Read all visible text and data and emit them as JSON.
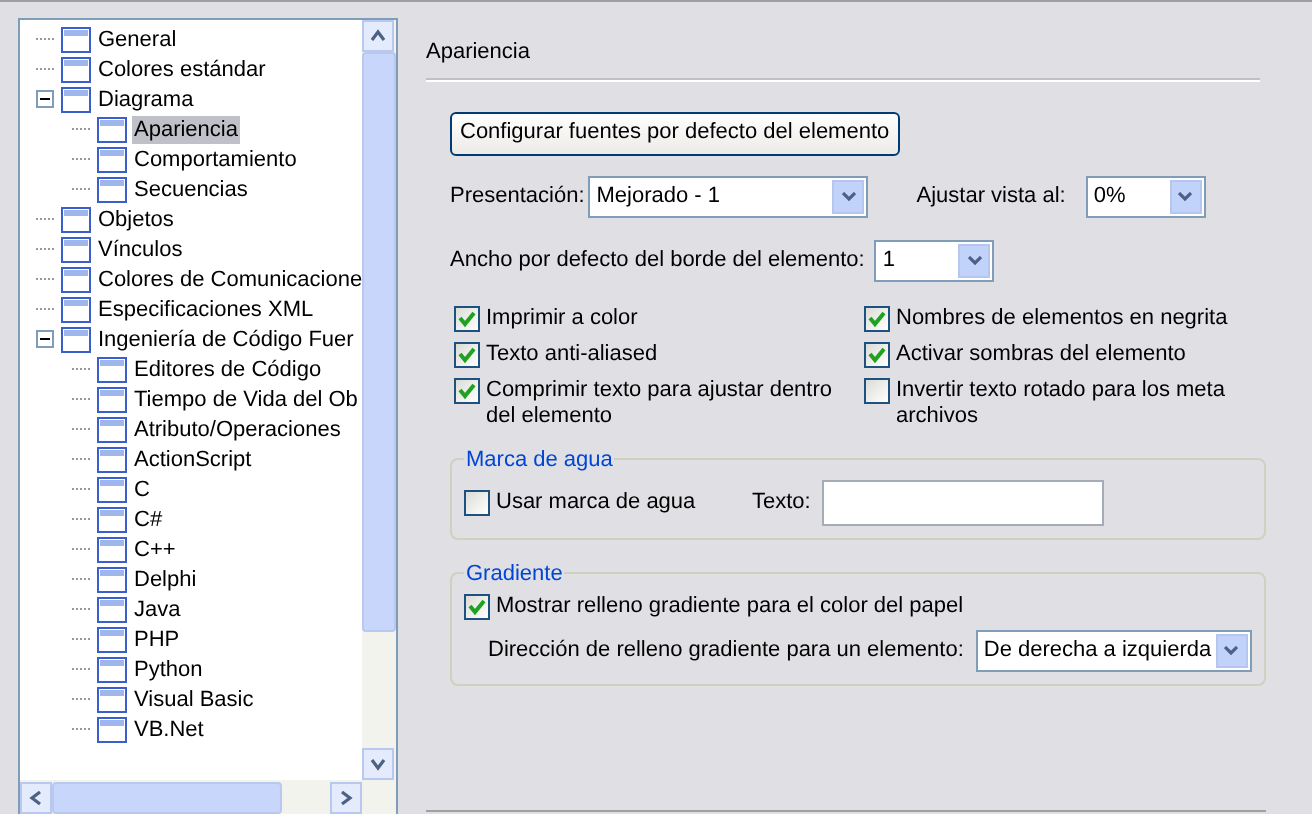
{
  "tree": {
    "items": [
      {
        "label": "General",
        "selected": false
      },
      {
        "label": "Colores estándar",
        "selected": false
      },
      {
        "label": "Diagrama",
        "expanded": true,
        "selected": false,
        "children": [
          {
            "label": "Apariencia",
            "selected": true
          },
          {
            "label": "Comportamiento",
            "selected": false
          },
          {
            "label": "Secuencias",
            "selected": false
          }
        ]
      },
      {
        "label": "Objetos",
        "selected": false
      },
      {
        "label": "Vínculos",
        "selected": false
      },
      {
        "label": "Colores de Comunicacione",
        "selected": false
      },
      {
        "label": "Especificaciones XML",
        "selected": false
      },
      {
        "label": "Ingeniería de Código Fuer",
        "expanded": true,
        "selected": false,
        "children": [
          {
            "label": "Editores de Código",
            "selected": false
          },
          {
            "label": "Tiempo de Vida del Ob",
            "selected": false
          },
          {
            "label": "Atributo/Operaciones",
            "selected": false
          },
          {
            "label": "ActionScript",
            "selected": false
          },
          {
            "label": "C",
            "selected": false
          },
          {
            "label": "C#",
            "selected": false
          },
          {
            "label": "C++",
            "selected": false
          },
          {
            "label": "Delphi",
            "selected": false
          },
          {
            "label": "Java",
            "selected": false
          },
          {
            "label": "PHP",
            "selected": false
          },
          {
            "label": "Python",
            "selected": false
          },
          {
            "label": "Visual Basic",
            "selected": false
          },
          {
            "label": "VB.Net",
            "selected": false
          }
        ]
      }
    ]
  },
  "panel": {
    "title": "Apariencia",
    "font_button": "Configurar fuentes por defecto del elemento",
    "presentation": {
      "label": "Presentación:",
      "value": "Mejorado - 1"
    },
    "zoom": {
      "label": "Ajustar vista al:",
      "value": "0%"
    },
    "border_width": {
      "label": "Ancho por defecto del borde del elemento:",
      "value": "1"
    },
    "checkboxes": [
      {
        "label": "Imprimir a color",
        "checked": true
      },
      {
        "label": "Nombres de elementos en negrita",
        "checked": true
      },
      {
        "label": "Texto anti-aliased",
        "checked": true
      },
      {
        "label": "Activar sombras del elemento",
        "checked": true
      },
      {
        "label": "Comprimir texto para ajustar dentro del elemento",
        "checked": true
      },
      {
        "label": "Invertir texto rotado para los meta archivos",
        "checked": false
      }
    ],
    "watermark": {
      "title": "Marca de agua",
      "checkbox": {
        "label": "Usar marca de agua",
        "checked": false
      },
      "text_label": "Texto:"
    },
    "gradient": {
      "title": "Gradiente",
      "checkbox": {
        "label": "Mostrar relleno gradiente para el color del papel",
        "checked": true
      },
      "direction_label": "Dirección de relleno gradiente para un elemento:",
      "direction_value": "De derecha a izquierda"
    }
  }
}
